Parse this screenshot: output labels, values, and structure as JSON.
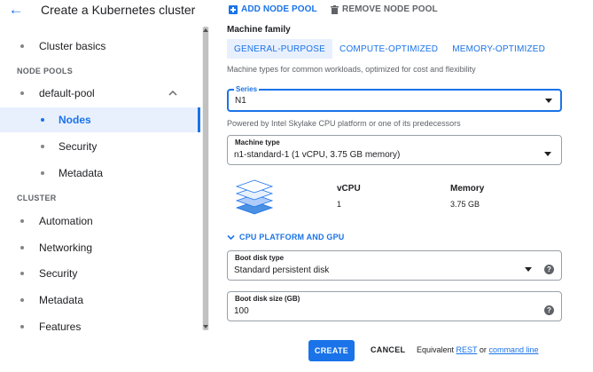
{
  "header": {
    "title": "Create a Kubernetes cluster",
    "add_node_pool": "ADD NODE POOL",
    "remove_node_pool": "REMOVE NODE POOL"
  },
  "sidebar": {
    "cluster_basics": "Cluster basics",
    "node_pools_header": "NODE POOLS",
    "default_pool": "default-pool",
    "pool_items": [
      "Nodes",
      "Security",
      "Metadata"
    ],
    "active_item": "Nodes",
    "cluster_header": "CLUSTER",
    "cluster_items": [
      "Automation",
      "Networking",
      "Security",
      "Metadata",
      "Features"
    ]
  },
  "main": {
    "machine_family_label": "Machine family",
    "family_tabs": [
      "GENERAL-PURPOSE",
      "COMPUTE-OPTIMIZED",
      "MEMORY-OPTIMIZED"
    ],
    "selected_family": "GENERAL-PURPOSE",
    "family_helper": "Machine types for common workloads, optimized for cost and flexibility",
    "series": {
      "label": "Series",
      "value": "N1"
    },
    "series_helper": "Powered by Intel Skylake CPU platform or one of its predecessors",
    "machine_type": {
      "label": "Machine type",
      "value": "n1-standard-1 (1 vCPU, 3.75 GB memory)"
    },
    "specs": {
      "vcpu_header": "vCPU",
      "vcpu_value": "1",
      "memory_header": "Memory",
      "memory_value": "3.75 GB"
    },
    "cpu_platform_toggle": "CPU PLATFORM AND GPU",
    "boot_disk_type": {
      "label": "Boot disk type",
      "value": "Standard persistent disk"
    },
    "boot_disk_size": {
      "label": "Boot disk size (GB)",
      "value": "100"
    }
  },
  "footer": {
    "create": "CREATE",
    "cancel": "CANCEL",
    "equivalent": "Equivalent",
    "rest": "REST",
    "or": "or",
    "command_line": "command line"
  },
  "colors": {
    "accent": "#1a73e8",
    "active_bg": "#e8f0fe",
    "muted_text": "#5f6368"
  }
}
